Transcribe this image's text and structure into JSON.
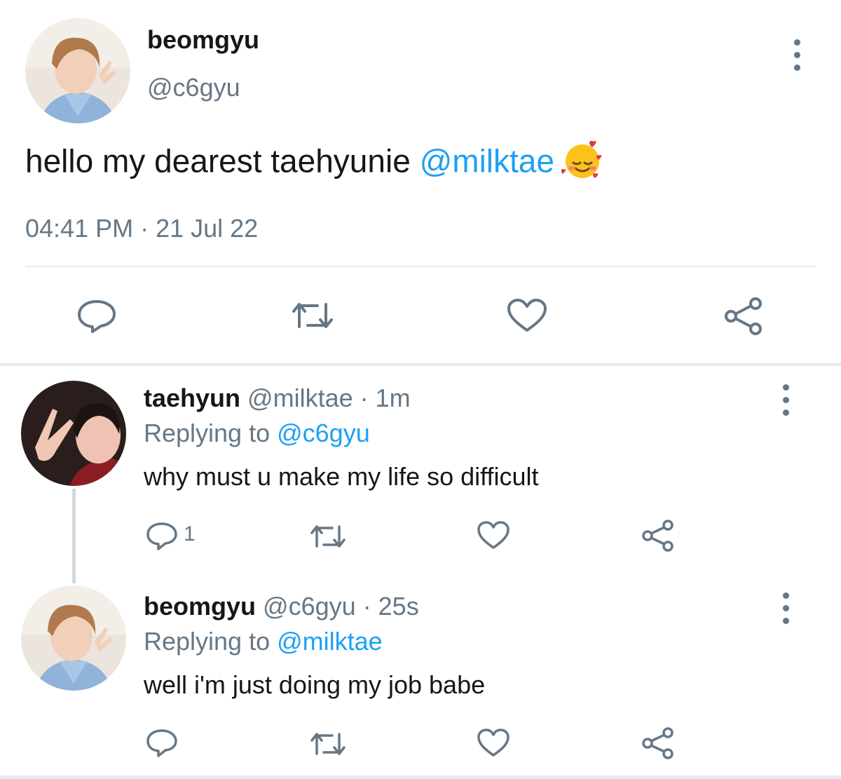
{
  "main_tweet": {
    "display_name": "beomgyu",
    "handle": "@c6gyu",
    "text": "hello my dearest taehyunie ",
    "mention": "@milktae",
    "emoji": "smiling-face-with-hearts",
    "timestamp": "04:41 PM · 21 Jul 22",
    "actions": [
      "reply-icon",
      "retweet-icon",
      "like-icon",
      "share-icon"
    ]
  },
  "replies": [
    {
      "display_name": "taehyun",
      "handle": "@milktae",
      "time": "· 1m",
      "replying_prefix": "Replying to ",
      "replying_to": "@c6gyu",
      "text": "why must u make my life so difficult",
      "reply_count": "1"
    },
    {
      "display_name": "beomgyu",
      "handle": "@c6gyu",
      "time": "· 25s",
      "replying_prefix": "Replying to ",
      "replying_to": "@milktae",
      "text": "well i'm just doing my job babe",
      "reply_count": ""
    }
  ],
  "colors": {
    "accent": "#1da1f2",
    "secondary_text": "#657786",
    "divider": "#e6ecf0"
  }
}
